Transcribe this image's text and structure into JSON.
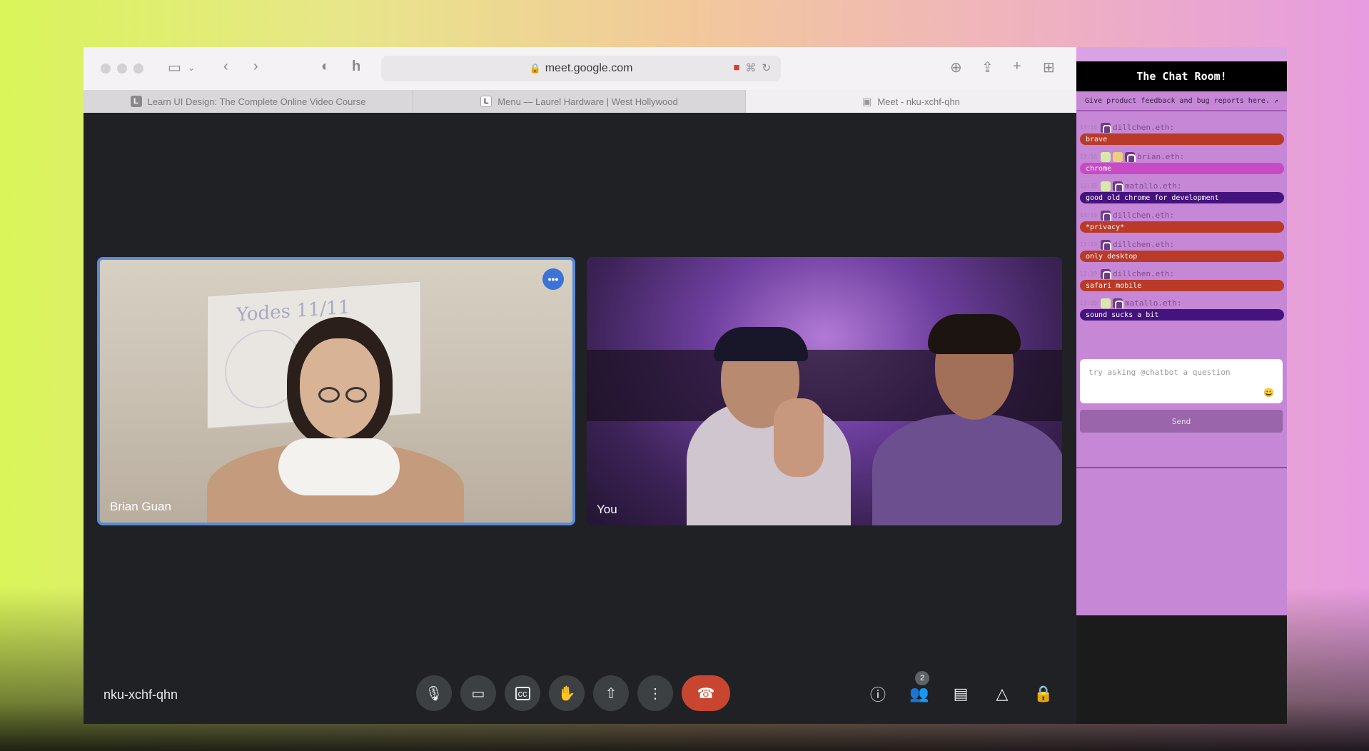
{
  "browser": {
    "url": "meet.google.com",
    "tabs": [
      {
        "label": "Learn UI Design: The Complete Online Video Course",
        "favicon": "L"
      },
      {
        "label": "Menu — Laurel Hardware | West Hollywood",
        "favicon": "L"
      },
      {
        "label": "Meet - nku-xchf-qhn",
        "favicon": "meet-icon"
      }
    ]
  },
  "meet": {
    "participants": [
      {
        "name": "Brian Guan"
      },
      {
        "name": "You"
      }
    ],
    "meeting_code": "nku-xchf-qhn",
    "people_count": "2",
    "whiteboard_text": "Yodes 11/11"
  },
  "chat": {
    "title": "The Chat Room!",
    "notice": "Give product feedback and bug reports here. ↗",
    "messages": [
      {
        "time": "13:16",
        "user": "dillchen.eth:",
        "text": "brave",
        "color": "#b93a28"
      },
      {
        "time": "13:18",
        "user": "brian.eth:",
        "text": "chrome",
        "color": "#c84ac4"
      },
      {
        "time": "13:19",
        "user": "matallo.eth:",
        "text": "good old chrome for development",
        "color": "#44137e"
      },
      {
        "time": "13:19",
        "user": "dillchen.eth:",
        "text": "*privacy*",
        "color": "#b93a28"
      },
      {
        "time": "13:19",
        "user": "dillchen.eth:",
        "text": "only desktop",
        "color": "#b93a28"
      },
      {
        "time": "13:19",
        "user": "dillchen.eth:",
        "text": "safari mobile",
        "color": "#b93a28"
      },
      {
        "time": "13:20",
        "user": "matallo.eth:",
        "text": "sound sucks a bit",
        "color": "#44137e"
      }
    ],
    "input_placeholder": "try asking @chatbot a question",
    "send_label": "Send"
  },
  "colors": {
    "accent_blue": "#5a8bd6",
    "end_call": "#c8462f",
    "chat_bg": "#c587d6"
  }
}
